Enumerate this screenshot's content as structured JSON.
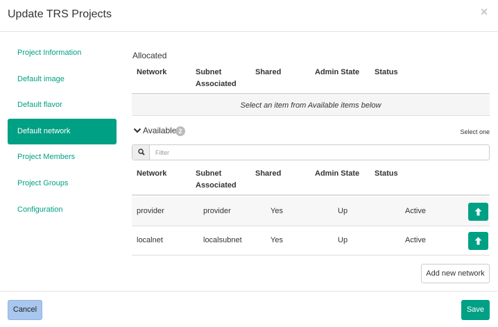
{
  "header": {
    "title": "Update TRS Projects",
    "close_glyph": "×"
  },
  "sidebar": {
    "items": [
      {
        "label": "Project Information",
        "active": false
      },
      {
        "label": "Default image",
        "active": false
      },
      {
        "label": "Default flavor",
        "active": false
      },
      {
        "label": "Default network",
        "active": true
      },
      {
        "label": "Project Members",
        "active": false
      },
      {
        "label": "Project Groups",
        "active": false
      },
      {
        "label": "Configuration",
        "active": false
      }
    ]
  },
  "allocated": {
    "title": "Allocated",
    "columns": [
      "Network",
      "Subnet\nAssociated",
      "Shared",
      "Admin State",
      "Status"
    ],
    "empty_message": "Select an item from Available items below"
  },
  "available": {
    "title": "Available",
    "count": "2",
    "select_hint": "Select one",
    "filter_placeholder": "Filter",
    "columns": [
      "Network",
      "Subnet\nAssociated",
      "Shared",
      "Admin State",
      "Status"
    ],
    "rows": [
      {
        "network": "provider",
        "subnet": "provider",
        "shared": "Yes",
        "admin_state": "Up",
        "status": "Active"
      },
      {
        "network": "localnet",
        "subnet": "localsubnet",
        "shared": "Yes",
        "admin_state": "Up",
        "status": "Active"
      }
    ],
    "add_button": "Add new network"
  },
  "footer": {
    "cancel_label": "Cancel",
    "save_label": "Save"
  },
  "colors": {
    "accent": "#00a085",
    "cancel_bg": "#a8c6ee",
    "badge": "#bbbbbb"
  }
}
